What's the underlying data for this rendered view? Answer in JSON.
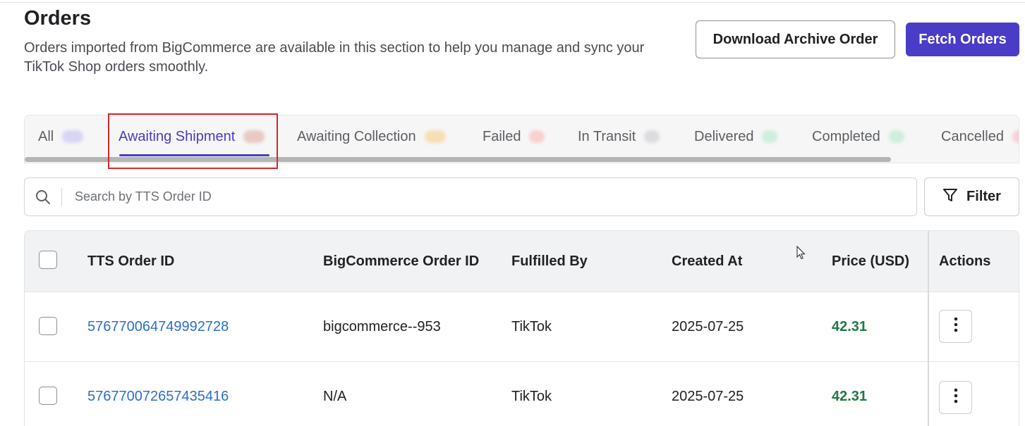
{
  "header": {
    "title": "Orders",
    "description": "Orders imported from BigCommerce are available in this section to help you manage and sync your TikTok Shop orders smoothly.",
    "download_button": "Download Archive Order",
    "fetch_button": "Fetch Orders"
  },
  "tabs": [
    {
      "label": "All",
      "badge_color": "#d8d5f5"
    },
    {
      "label": "Awaiting Shipment",
      "badge_color": "#e9c9c4",
      "active": true
    },
    {
      "label": "Awaiting Collection",
      "badge_color": "#f7dfb5"
    },
    {
      "label": "Failed",
      "badge_color": "#f8d0d0"
    },
    {
      "label": "In Transit",
      "badge_color": "#dcdcdf"
    },
    {
      "label": "Delivered",
      "badge_color": "#cfeedd"
    },
    {
      "label": "Completed",
      "badge_color": "#cfeedd"
    },
    {
      "label": "Cancelled",
      "badge_color": "#f8d0d8"
    }
  ],
  "search": {
    "placeholder": "Search by TTS Order ID",
    "value": ""
  },
  "filter_button": "Filter",
  "table": {
    "columns": [
      "TTS Order ID",
      "BigCommerce Order ID",
      "Fulfilled By",
      "Created At",
      "Price (USD)",
      "Actions"
    ],
    "rows": [
      {
        "tts_order_id": "576770064749992728",
        "bigcommerce_order_id": "bigcommerce--953",
        "fulfilled_by": "TikTok",
        "created_at": "2025-07-25",
        "price": "42.31"
      },
      {
        "tts_order_id": "576770072657435416",
        "bigcommerce_order_id": "N/A",
        "fulfilled_by": "TikTok",
        "created_at": "2025-07-25",
        "price": "42.31"
      }
    ]
  },
  "colors": {
    "accent": "#4a3cc7",
    "link": "#2c6ecb",
    "price": "#1f7a44",
    "highlight": "#d42a2a"
  }
}
